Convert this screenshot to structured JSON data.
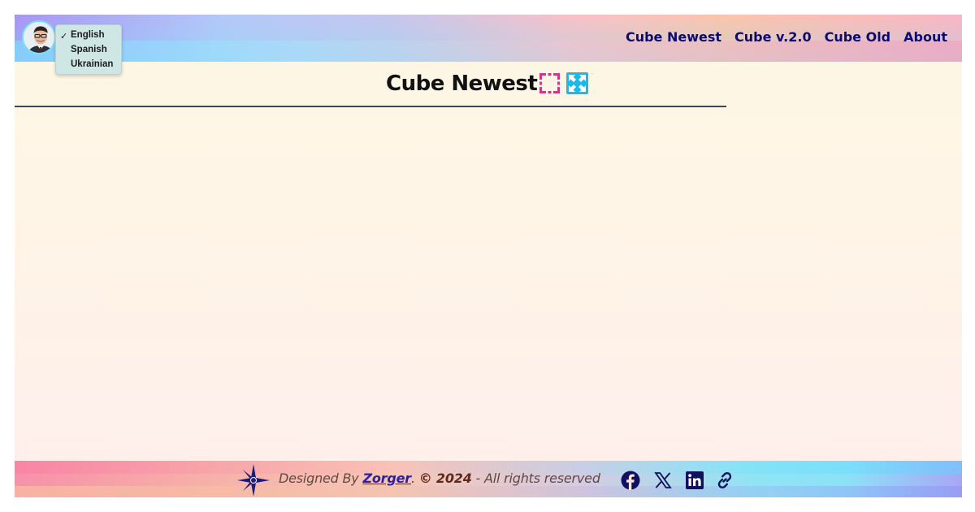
{
  "header": {
    "avatar_alt": "profile photo",
    "language_menu": {
      "selected_mark": "✓",
      "options": [
        "English",
        "Spanish",
        "Ukrainian"
      ],
      "selected": "English"
    },
    "nav": [
      "Cube Newest",
      "Cube v.2.0",
      "Cube Old",
      "About"
    ]
  },
  "main": {
    "title": "Cube Newest",
    "icons": [
      "focus-frame-icon",
      "expand-arrows-icon"
    ]
  },
  "footer": {
    "designed_by": "Designed By ",
    "author": "Zorger",
    "sep": ". ",
    "copyright": "© 2024",
    "rights": " - All rights reserved",
    "social_icons": [
      "facebook-icon",
      "x-icon",
      "linkedin-icon",
      "link-icon"
    ]
  },
  "colors": {
    "nav_text": "#0c0c70",
    "accent_pink": "#d0368b",
    "accent_cyan": "#1cb8ea",
    "footer_icon": "#10105e"
  }
}
